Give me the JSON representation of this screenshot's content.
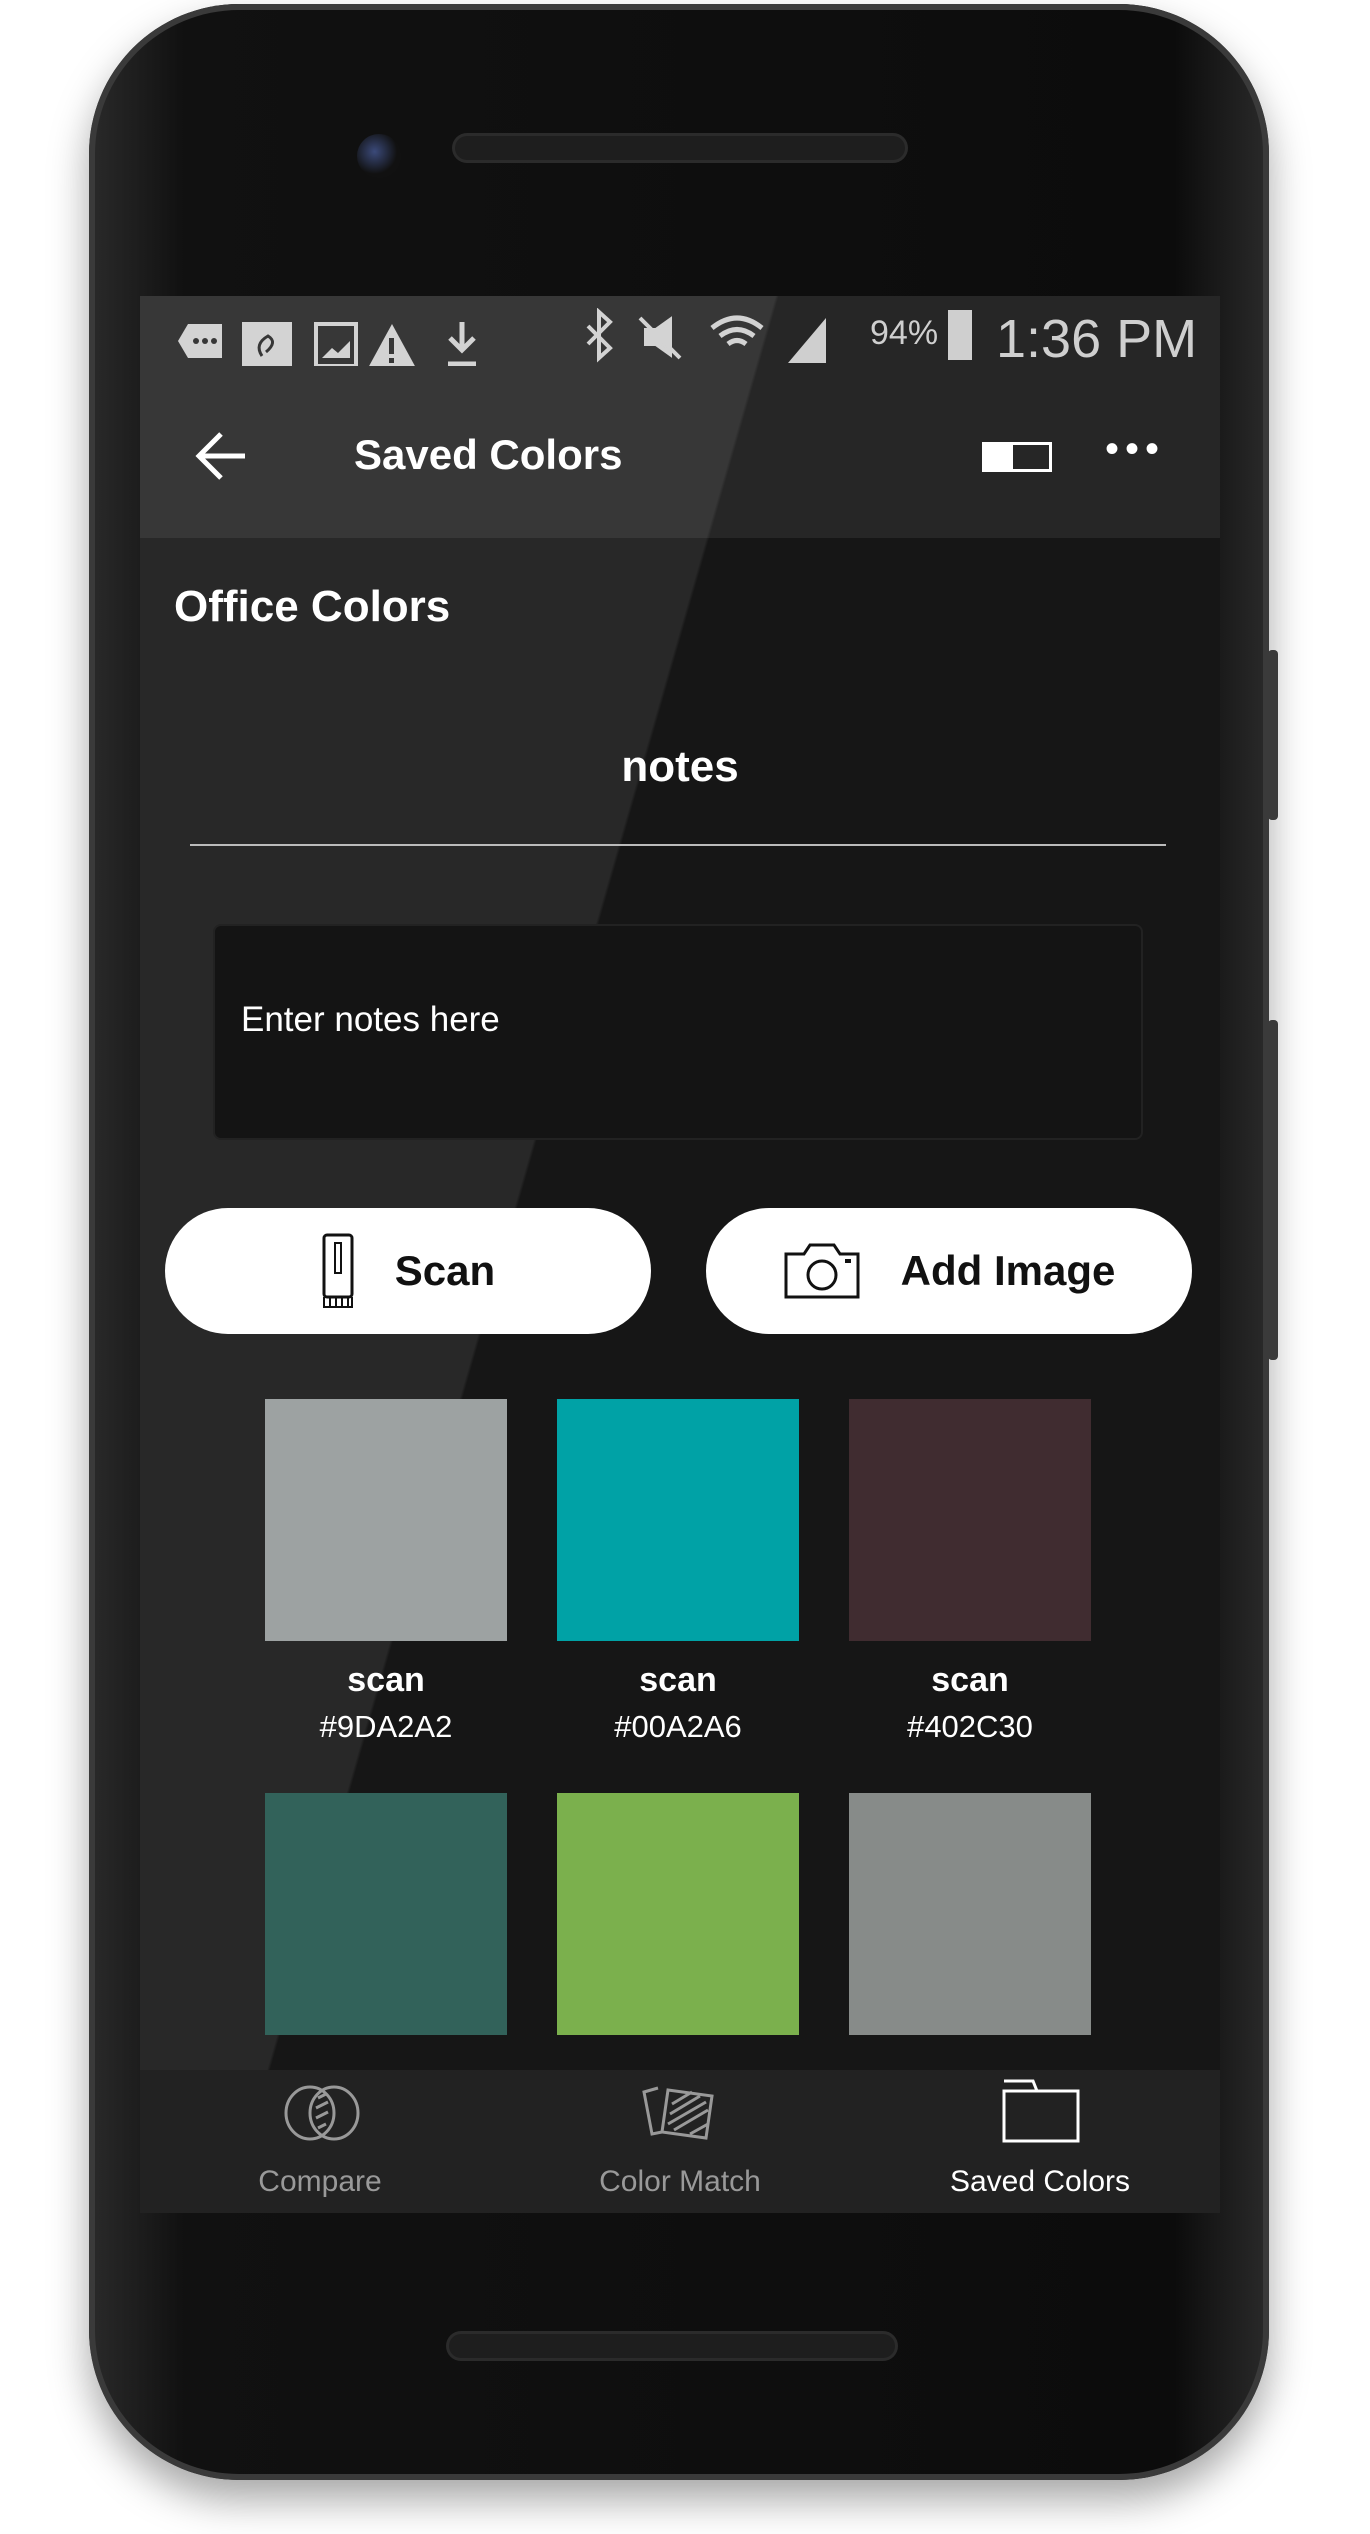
{
  "status_bar": {
    "battery_percent": "94%",
    "time": "1:36 PM"
  },
  "app_bar": {
    "title": "Saved Colors"
  },
  "palette_name": "Office Colors",
  "notes": {
    "heading": "notes",
    "placeholder": "Enter notes here"
  },
  "actions": {
    "scan_label": "Scan",
    "add_image_label": "Add Image"
  },
  "swatches": [
    {
      "label": "scan",
      "hex": "#9DA2A2",
      "color": "#9DA2A2"
    },
    {
      "label": "scan",
      "hex": "#00A2A6",
      "color": "#00A2A6"
    },
    {
      "label": "scan",
      "hex": "#402C30",
      "color": "#402C30"
    },
    {
      "color": "#32625A"
    },
    {
      "color": "#7BB04D"
    },
    {
      "color": "#878B89"
    }
  ],
  "bottom_nav": [
    {
      "label": "Compare",
      "icon": "compare-icon",
      "active": false
    },
    {
      "label": "Color Match",
      "icon": "color-match-icon",
      "active": false
    },
    {
      "label": "Saved Colors",
      "icon": "folder-icon",
      "active": true
    }
  ]
}
